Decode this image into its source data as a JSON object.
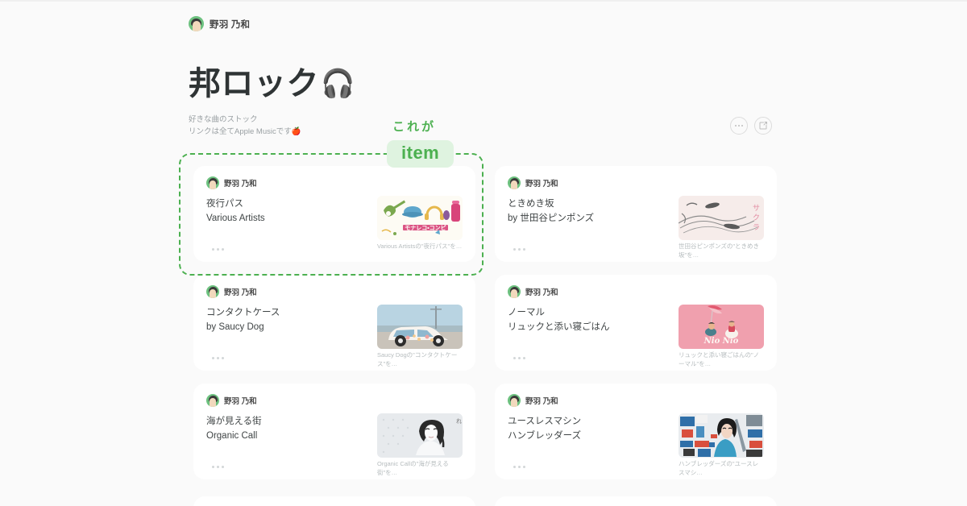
{
  "owner": {
    "name": "野羽 乃和",
    "avatar_icon": "person-avatar-icon"
  },
  "header": {
    "title": "邦ロック",
    "title_emoji": "🎧",
    "subtitle": "好きな曲のストック\nリンクは全てApple Musicです🍎",
    "actions": [
      {
        "name": "more-options-button",
        "icon": "ellipsis-icon",
        "label": "…"
      },
      {
        "name": "share-button",
        "icon": "share-export-icon",
        "label": "共有"
      }
    ]
  },
  "annotation": {
    "caption": "これが",
    "badge": "item",
    "accent_color": "#4cb050",
    "badge_bg": "#dff3e0"
  },
  "colors": {
    "page_bg": "#fafafa",
    "card_bg": "#ffffff",
    "text_primary": "#3f4445",
    "text_muted": "#b6bcbe",
    "avatar_green": "#6dc17f"
  },
  "items": [
    {
      "owner": "野羽 乃和",
      "title": "夜行パス",
      "artist": "Various Artists",
      "preview_caption": "Various Artistsの\"夜行パス\"を…",
      "thumb": "monareco-compi-artwork",
      "more_label": "…"
    },
    {
      "owner": "野羽 乃和",
      "title": "ときめき坂",
      "artist": "by 世田谷ピンポンズ",
      "preview_caption": "世田谷ピンポンズの\"ときめき坂\"を…",
      "thumb": "tokimeki-zaka-artwork",
      "more_label": "…"
    },
    {
      "owner": "野羽 乃和",
      "title": "コンタクトケース",
      "artist": "by Saucy Dog",
      "preview_caption": "Saucy Dogの\"コンタクトケース\"を…",
      "thumb": "saucy-dog-van-artwork",
      "more_label": "…"
    },
    {
      "owner": "野羽 乃和",
      "title": "ノーマル",
      "artist": "リュックと添い寝ごはん",
      "preview_caption": "リュックと添い寝ごはんの\"ノーマル\"を…",
      "thumb": "nio-nio-pink-artwork",
      "more_label": "…"
    },
    {
      "owner": "野羽 乃和",
      "title": "海が見える街",
      "artist": "Organic Call",
      "preview_caption": "Organic Callの\"海が見える街\"を…",
      "thumb": "organic-call-girl-artwork",
      "more_label": "…"
    },
    {
      "owner": "野羽 乃和",
      "title": "ユースレスマシン",
      "artist": "ハンブレッダーズ",
      "preview_caption": "ハンブレッダーズの\"ユースレスマシ…",
      "thumb": "humbreaders-artwork",
      "more_label": "…"
    }
  ]
}
